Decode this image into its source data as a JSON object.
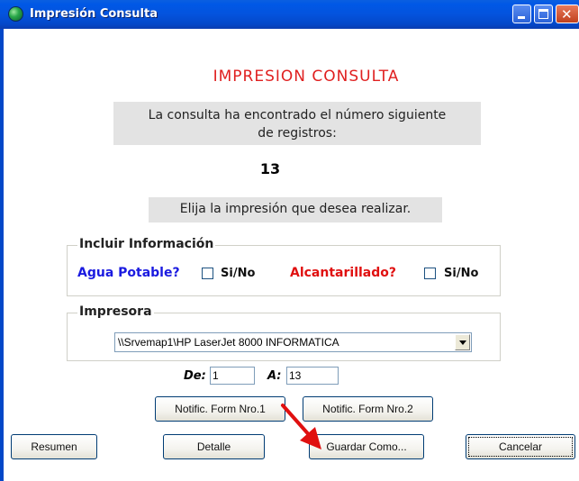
{
  "window": {
    "title": "Impresión Consulta"
  },
  "heading": "IMPRESION CONSULTA",
  "message": {
    "line1": "La consulta ha encontrado el número siguiente",
    "line2": "de registros:"
  },
  "record_count": "13",
  "prompt": "Elija la impresión que desea realizar.",
  "include_info": {
    "legend": "Incluir Información",
    "agua_label": "Agua Potable?",
    "agua_checkbox_label": "Si/No",
    "agua_checked": false,
    "alcant_label": "Alcantarillado?",
    "alcant_checkbox_label": "Si/No",
    "alcant_checked": false
  },
  "printer": {
    "legend": "Impresora",
    "selected": "\\\\Srvemap1\\HP LaserJet 8000 INFORMATICA"
  },
  "range": {
    "from_label": "De:",
    "from_value": "1",
    "to_label": "A:",
    "to_value": "13"
  },
  "buttons": {
    "form1": "Notific. Form Nro.1",
    "form2": "Notific. Form Nro.2",
    "resumen": "Resumen",
    "detalle": "Detalle",
    "guardar": "Guardar Como...",
    "cancelar": "Cancelar"
  },
  "colors": {
    "heading": "#e02020",
    "agua": "#1a1ae0",
    "alcant": "#e01010",
    "annotation_arrow": "#e01010"
  }
}
